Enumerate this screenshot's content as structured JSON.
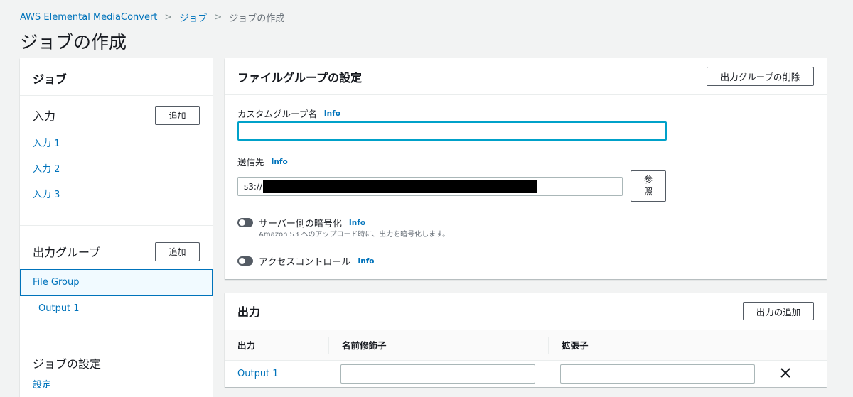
{
  "breadcrumb": {
    "items": [
      "AWS Elemental MediaConvert",
      "ジョブ"
    ],
    "current": "ジョブの作成"
  },
  "page_title": "ジョブの作成",
  "left_panel": {
    "title": "ジョブ",
    "inputs": {
      "title": "入力",
      "add_label": "追加",
      "items": [
        "入力 1",
        "入力 2",
        "入力 3"
      ]
    },
    "output_groups": {
      "title": "出力グループ",
      "add_label": "追加",
      "selected_group": "File Group",
      "outputs": [
        "Output 1"
      ]
    },
    "job_settings": {
      "title": "ジョブの設定",
      "link": "設定"
    }
  },
  "file_group_panel": {
    "title": "ファイルグループの設定",
    "delete_label": "出力グループの削除",
    "custom_group_name": {
      "label": "カスタムグループ名",
      "info": "Info",
      "value": ""
    },
    "destination": {
      "label": "送信先",
      "info": "Info",
      "value_prefix": "s3://",
      "browse_label": "参照"
    },
    "encryption": {
      "label": "サーバー側の暗号化",
      "info": "Info",
      "description": "Amazon S3 へのアップロード時に、出力を暗号化します。",
      "enabled": false
    },
    "access_control": {
      "label": "アクセスコントロール",
      "info": "Info",
      "enabled": false
    }
  },
  "outputs_panel": {
    "title": "出力",
    "add_label": "出力の追加",
    "columns": [
      "出力",
      "名前修飾子",
      "拡張子"
    ],
    "rows": [
      {
        "output": "Output 1",
        "name_modifier": "",
        "extension": ""
      }
    ],
    "remove_icon": "close-icon"
  },
  "colors": {
    "link": "#0073bb",
    "focus": "#00a1c9",
    "background": "#f2f3f3"
  }
}
